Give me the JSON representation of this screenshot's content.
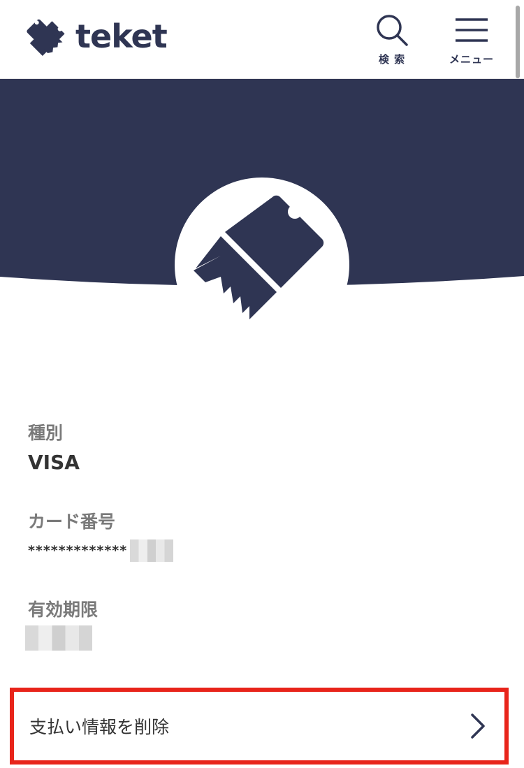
{
  "header": {
    "logo_text": "teket",
    "search_label": "検 索",
    "menu_label": "メニュー",
    "icons": {
      "logo": "ticket-icon",
      "search": "search-icon",
      "menu": "hamburger-menu-icon"
    }
  },
  "hero": {
    "avatar_icon": "ticket-icon"
  },
  "payment": {
    "type_label": "種別",
    "type_value": "VISA",
    "card_label": "カード番号",
    "card_value": "*************",
    "expiry_label": "有効期限"
  },
  "actions": {
    "delete_label": "支払い情報を削除",
    "delete_icon": "chevron-right-icon"
  },
  "colors": {
    "brand_navy": "#2f3553",
    "highlight_red": "#e8241a",
    "label_gray": "#7a7a7a"
  }
}
